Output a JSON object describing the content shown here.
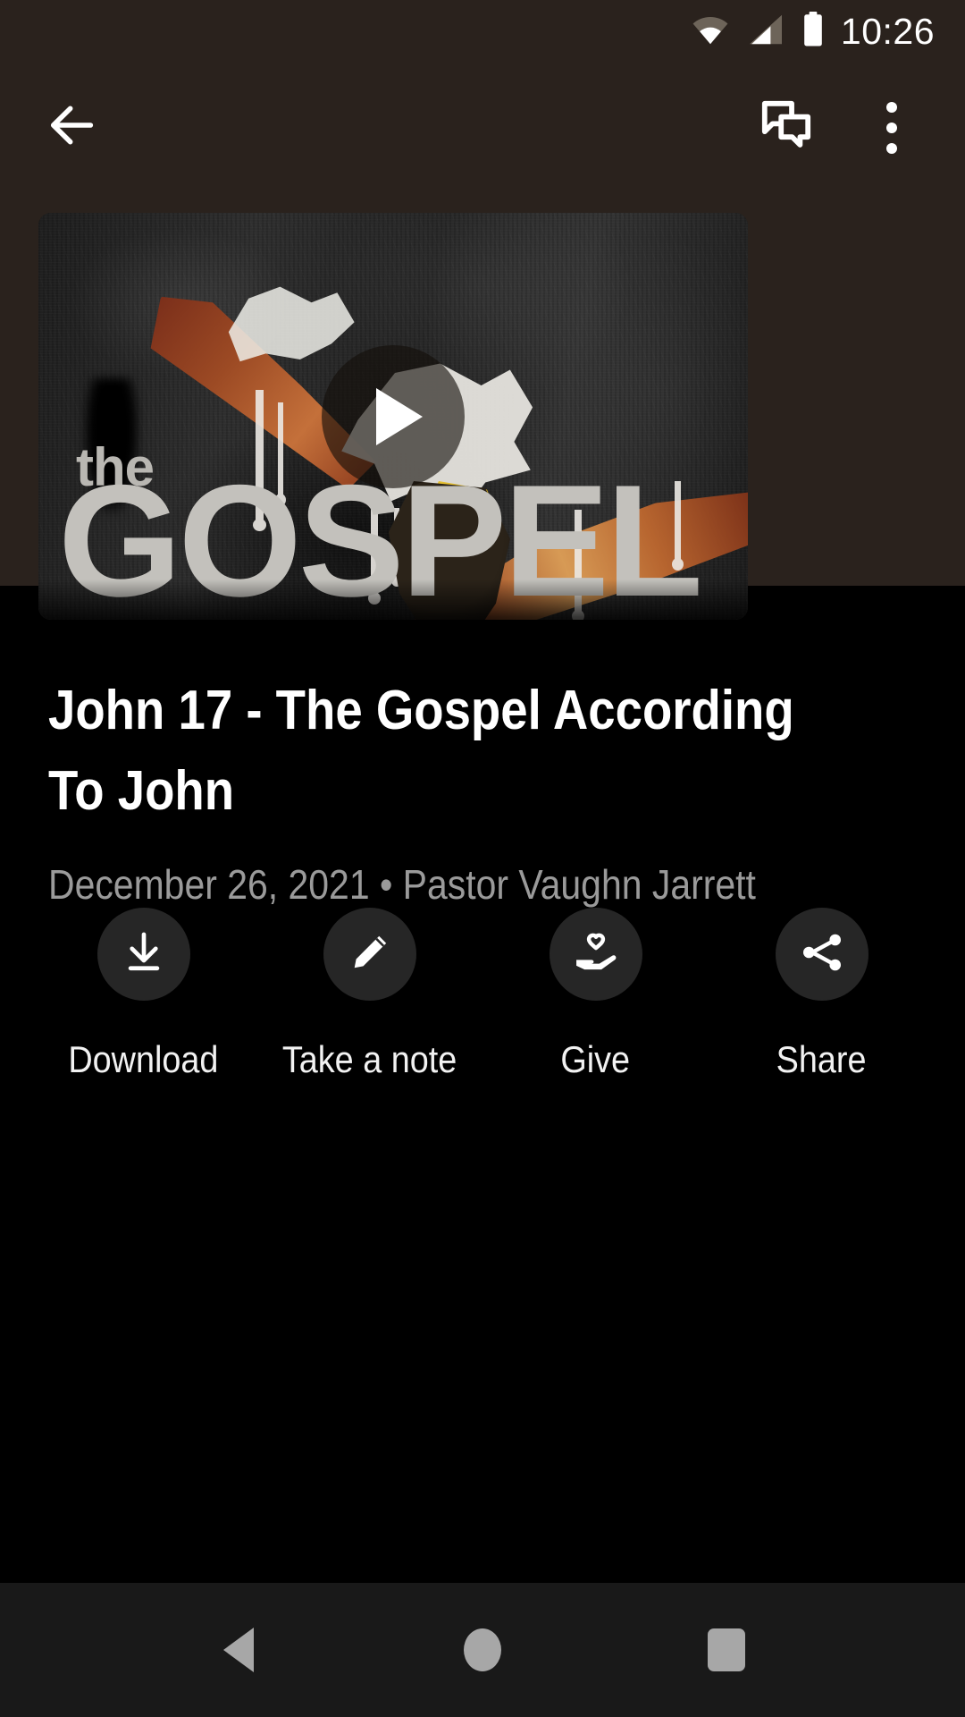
{
  "status_bar": {
    "time": "10:26",
    "icons": [
      "wifi-icon",
      "cellular-signal-icon",
      "battery-icon"
    ]
  },
  "toolbar": {
    "back_icon": "back-arrow-icon",
    "chat_icon": "chat-bubbles-icon",
    "overflow_icon": "more-vertical-icon"
  },
  "media": {
    "play_icon": "play-icon",
    "artwork_text_small": "the",
    "artwork_text_large": "GOSPEL"
  },
  "sermon": {
    "title": "John 17 - The Gospel According To John",
    "meta": "December 26, 2021 • Pastor Vaughn Jarrett",
    "date": "December 26, 2021",
    "speaker": "Pastor Vaughn Jarrett"
  },
  "actions": [
    {
      "label": "Download",
      "icon": "download-icon"
    },
    {
      "label": "Take a note",
      "icon": "pencil-icon"
    },
    {
      "label": "Give",
      "icon": "hand-heart-icon"
    },
    {
      "label": "Share",
      "icon": "share-nodes-icon"
    }
  ],
  "nav_bar": {
    "back": "nav-back-icon",
    "home": "nav-home-icon",
    "recents": "nav-recents-icon"
  },
  "colors": {
    "toolbar_bg": "#2a221d",
    "page_bg": "#000000",
    "action_circle": "#262626",
    "subtitle_text": "#9a9a9a",
    "nav_bg": "#191919"
  }
}
